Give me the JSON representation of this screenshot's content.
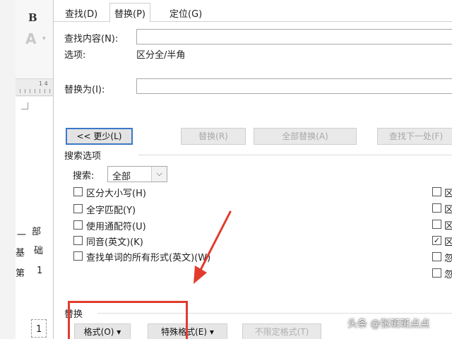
{
  "background_doc": {
    "bold_label": "B",
    "font_color_label": "A",
    "font_color_caret": "▾",
    "ruler_number": "1 4",
    "text_chars": [
      "部",
      "一",
      "础",
      "基",
      "1",
      "第",
      "1"
    ]
  },
  "dialog": {
    "tabs": [
      {
        "label": "查找(D)"
      },
      {
        "label": "替换(P)"
      },
      {
        "label": "定位(G)"
      }
    ],
    "find_label": "查找内容(N):",
    "find_value": "",
    "options_label": "选项:",
    "options_value": "区分全/半角",
    "replace_label": "替换为(I):",
    "replace_value": "",
    "buttons": {
      "less": "<< 更少(L)",
      "replace": "替换(R)",
      "replace_all": "全部替换(A)",
      "find_next": "查找下一处(F)"
    },
    "search_options": {
      "header": "搜索选项",
      "search_label": "搜索:",
      "search_value": "全部",
      "checkboxes": [
        {
          "label": "区分大小写(H)",
          "checked": false
        },
        {
          "label": "全字匹配(Y)",
          "checked": false
        },
        {
          "label": "使用通配符(U)",
          "checked": false
        },
        {
          "label": "同音(英文)(K)",
          "checked": false
        },
        {
          "label": "查找单词的所有形式(英文)(W)",
          "checked": false
        }
      ],
      "right_checkboxes": [
        {
          "label": "区",
          "checked": false
        },
        {
          "label": "区",
          "checked": false
        },
        {
          "label": "区",
          "checked": false
        },
        {
          "label": "区",
          "checked": true
        },
        {
          "label": "忽",
          "checked": false
        },
        {
          "label": "忽",
          "checked": false
        }
      ]
    },
    "replace_section": {
      "header": "替换",
      "format_button": "格式(O) ▾",
      "special_button": "特殊格式(E) ▾",
      "no_format_button": "不限定格式(T)"
    }
  },
  "watermark": "头条 @张斑斑点点",
  "colors": {
    "annotation_red": "#e23b2e",
    "focus_blue": "#3b78c9"
  }
}
